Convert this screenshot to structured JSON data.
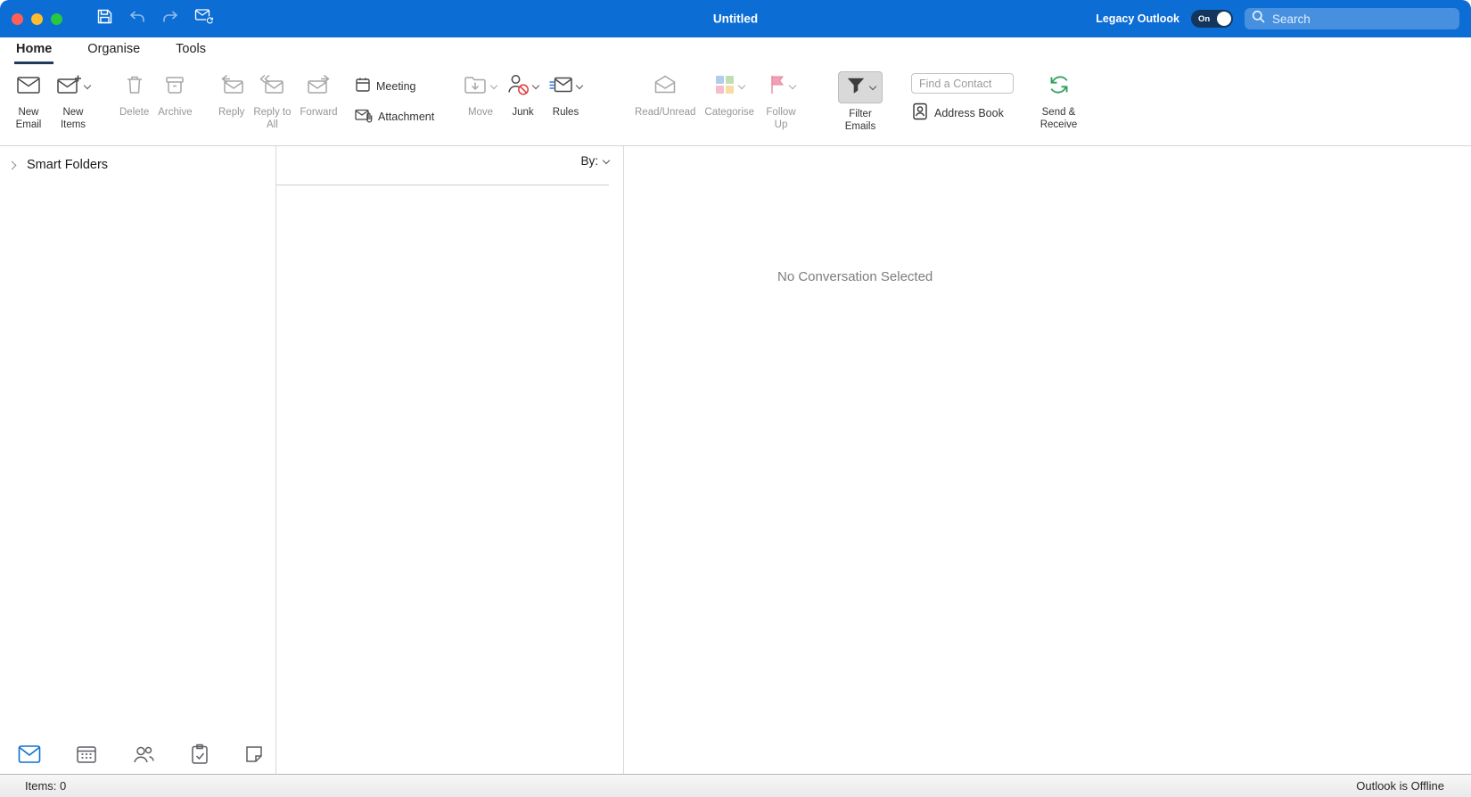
{
  "titlebar": {
    "title": "Untitled",
    "legacy_outlook_label": "Legacy Outlook",
    "toggle_label": "On",
    "search_placeholder": "Search"
  },
  "tabs": {
    "home": "Home",
    "organise": "Organise",
    "tools": "Tools"
  },
  "ribbon": {
    "new_email": "New Email",
    "new_items": "New Items",
    "delete": "Delete",
    "archive": "Archive",
    "reply": "Reply",
    "reply_to_all": "Reply to All",
    "forward": "Forward",
    "meeting": "Meeting",
    "attachment": "Attachment",
    "move": "Move",
    "junk": "Junk",
    "rules": "Rules",
    "read_unread": "Read/Unread",
    "categorise": "Categorise",
    "follow_up": "Follow Up",
    "filter_emails": "Filter Emails",
    "find_a_contact": "Find a Contact",
    "address_book": "Address Book",
    "send_receive": "Send & Receive"
  },
  "sidebar": {
    "smart_folders": "Smart Folders"
  },
  "list": {
    "by_label": "By:"
  },
  "reading_pane": {
    "empty_message": "No Conversation Selected"
  },
  "statusbar": {
    "items_count": "Items: 0",
    "connection_status": "Outlook is Offline"
  },
  "colors": {
    "titlebar_blue": "#0c6dd5",
    "accent_blue": "#0e6fd4",
    "active_tab_underline": "#1e3a5f"
  }
}
